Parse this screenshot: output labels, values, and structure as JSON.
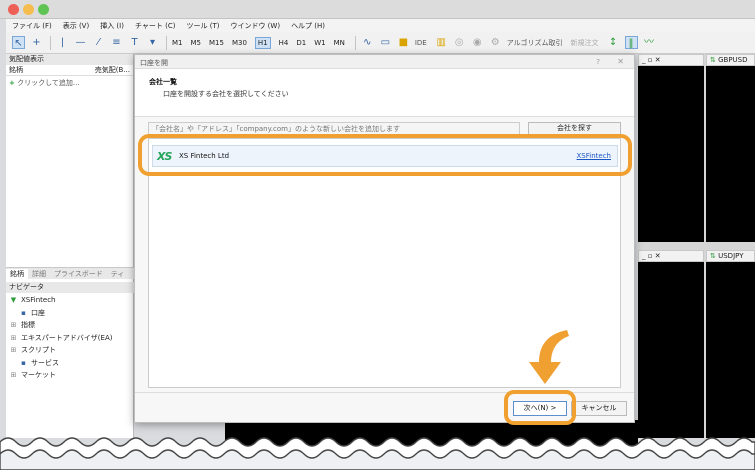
{
  "app": {
    "menus": [
      "ファイル (F)",
      "表示 (V)",
      "挿入 (I)",
      "チャート (C)",
      "ツール (T)",
      "ウインドウ (W)",
      "ヘルプ (H)"
    ],
    "timeframes": [
      "M1",
      "M5",
      "M15",
      "M30",
      "H1",
      "H4",
      "D1",
      "W1",
      "MN"
    ],
    "active_timeframe": "H1",
    "toolbar_text": {
      "ide": "IDE",
      "algo": "アルゴリズム取引",
      "new_order": "新規注文"
    }
  },
  "left_panel": {
    "title": "気配値表示",
    "col_symbol": "銘柄",
    "col_bid": "売気配(B...",
    "add_text": "クリックして追加...",
    "tabs": [
      "銘柄",
      "詳細",
      "プライスボード",
      "ティ"
    ],
    "navigator_title": "ナビゲータ",
    "nav_items": [
      {
        "label": "XSFintech",
        "icon": "▼"
      },
      {
        "label": "口座",
        "icon": "▪"
      },
      {
        "label": "指標",
        "icon": "⊞"
      },
      {
        "label": "エキスパートアドバイザ(EA)",
        "icon": "⊞"
      },
      {
        "label": "スクリプト",
        "icon": "⊞"
      },
      {
        "label": "サービス",
        "icon": "▪"
      },
      {
        "label": "マーケット",
        "icon": "⊞"
      }
    ]
  },
  "charts": {
    "top_right": "GBPUSD",
    "bottom_right": "USDJPY"
  },
  "dialog": {
    "title": "口座を開",
    "help": "?",
    "close": "✕",
    "heading": "会社一覧",
    "subheading": "口座を開設する会社を選択してください",
    "search_placeholder": "「会社名」や「アドレス」「company.com」のような新しい会社を追加します",
    "search_button": "会社を探す",
    "company": {
      "logo": "XS",
      "name": "XS Fintech Ltd",
      "link": "XSFintech"
    },
    "next_button": "次へ(N) >",
    "cancel_button": "キャンセル"
  }
}
